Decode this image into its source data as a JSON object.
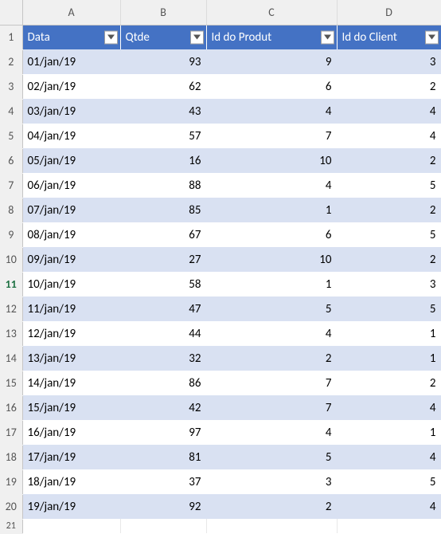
{
  "columns": [
    "A",
    "B",
    "C",
    "D"
  ],
  "headers": {
    "a": "Data",
    "b": "Qtde",
    "c": "Id do Produt",
    "d": "Id do Client"
  },
  "selected_row": 11,
  "last_partial_row": "21",
  "rows": [
    {
      "n": 1
    },
    {
      "n": 2,
      "a": "01/jan/19",
      "b": 93,
      "c": 9,
      "d": 3
    },
    {
      "n": 3,
      "a": "02/jan/19",
      "b": 62,
      "c": 6,
      "d": 2
    },
    {
      "n": 4,
      "a": "03/jan/19",
      "b": 43,
      "c": 4,
      "d": 4
    },
    {
      "n": 5,
      "a": "04/jan/19",
      "b": 57,
      "c": 7,
      "d": 4
    },
    {
      "n": 6,
      "a": "05/jan/19",
      "b": 16,
      "c": 10,
      "d": 2
    },
    {
      "n": 7,
      "a": "06/jan/19",
      "b": 88,
      "c": 4,
      "d": 5
    },
    {
      "n": 8,
      "a": "07/jan/19",
      "b": 85,
      "c": 1,
      "d": 2
    },
    {
      "n": 9,
      "a": "08/jan/19",
      "b": 67,
      "c": 6,
      "d": 5
    },
    {
      "n": 10,
      "a": "09/jan/19",
      "b": 27,
      "c": 10,
      "d": 2
    },
    {
      "n": 11,
      "a": "10/jan/19",
      "b": 58,
      "c": 1,
      "d": 3
    },
    {
      "n": 12,
      "a": "11/jan/19",
      "b": 47,
      "c": 5,
      "d": 5
    },
    {
      "n": 13,
      "a": "12/jan/19",
      "b": 44,
      "c": 4,
      "d": 1
    },
    {
      "n": 14,
      "a": "13/jan/19",
      "b": 32,
      "c": 2,
      "d": 1
    },
    {
      "n": 15,
      "a": "14/jan/19",
      "b": 86,
      "c": 7,
      "d": 2
    },
    {
      "n": 16,
      "a": "15/jan/19",
      "b": 42,
      "c": 7,
      "d": 4
    },
    {
      "n": 17,
      "a": "16/jan/19",
      "b": 97,
      "c": 4,
      "d": 1
    },
    {
      "n": 18,
      "a": "17/jan/19",
      "b": 81,
      "c": 5,
      "d": 4
    },
    {
      "n": 19,
      "a": "18/jan/19",
      "b": 37,
      "c": 3,
      "d": 5
    },
    {
      "n": 20,
      "a": "19/jan/19",
      "b": 92,
      "c": 2,
      "d": 4
    }
  ],
  "chart_data": {
    "type": "table",
    "title": "",
    "columns": [
      "Data",
      "Qtde",
      "Id do Produt",
      "Id do Client"
    ],
    "rows": [
      [
        "01/jan/19",
        93,
        9,
        3
      ],
      [
        "02/jan/19",
        62,
        6,
        2
      ],
      [
        "03/jan/19",
        43,
        4,
        4
      ],
      [
        "04/jan/19",
        57,
        7,
        4
      ],
      [
        "05/jan/19",
        16,
        10,
        2
      ],
      [
        "06/jan/19",
        88,
        4,
        5
      ],
      [
        "07/jan/19",
        85,
        1,
        2
      ],
      [
        "08/jan/19",
        67,
        6,
        5
      ],
      [
        "09/jan/19",
        27,
        10,
        2
      ],
      [
        "10/jan/19",
        58,
        1,
        3
      ],
      [
        "11/jan/19",
        47,
        5,
        5
      ],
      [
        "12/jan/19",
        44,
        4,
        1
      ],
      [
        "13/jan/19",
        32,
        2,
        1
      ],
      [
        "14/jan/19",
        86,
        7,
        2
      ],
      [
        "15/jan/19",
        42,
        7,
        4
      ],
      [
        "16/jan/19",
        97,
        4,
        1
      ],
      [
        "17/jan/19",
        81,
        5,
        4
      ],
      [
        "18/jan/19",
        37,
        3,
        5
      ],
      [
        "19/jan/19",
        92,
        2,
        4
      ]
    ]
  }
}
